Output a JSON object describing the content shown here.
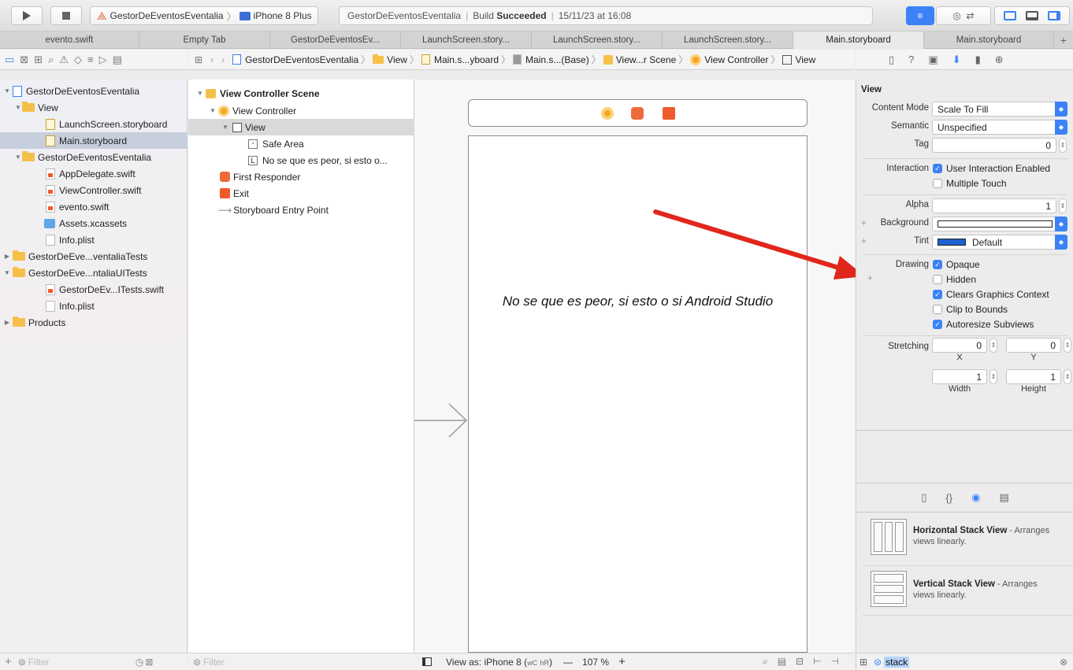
{
  "toolbar": {
    "scheme": "GestorDeEventosEventalia",
    "device": "iPhone 8 Plus",
    "status_project": "GestorDeEventosEventalia",
    "status_build_prefix": "Build",
    "status_build_result": "Succeeded",
    "status_date": "15/11/23 at 16:08"
  },
  "tabs": [
    "evento.swift",
    "Empty Tab",
    "GestorDeEventosEv...",
    "LaunchScreen.story...",
    "LaunchScreen.story...",
    "LaunchScreen.story...",
    "Main.storyboard",
    "Main.storyboard"
  ],
  "breadcrumb": [
    "GestorDeEventosEventalia",
    "View",
    "Main.s...yboard",
    "Main.s...(Base)",
    "View...r Scene",
    "View Controller",
    "View"
  ],
  "navigator": {
    "items": [
      {
        "label": "GestorDeEventosEventalia"
      },
      {
        "label": "View"
      },
      {
        "label": "LaunchScreen.storyboard"
      },
      {
        "label": "Main.storyboard"
      },
      {
        "label": "GestorDeEventosEventalia"
      },
      {
        "label": "AppDelegate.swift"
      },
      {
        "label": "ViewController.swift"
      },
      {
        "label": "evento.swift"
      },
      {
        "label": "Assets.xcassets"
      },
      {
        "label": "Info.plist"
      },
      {
        "label": "GestorDeEve...ventaliaTests"
      },
      {
        "label": "GestorDeEve...ntaliaUITests"
      },
      {
        "label": "GestorDeEv...ITests.swift"
      },
      {
        "label": "Info.plist"
      },
      {
        "label": "Products"
      }
    ],
    "filter_placeholder": "Filter"
  },
  "outline": {
    "items": [
      {
        "label": "View Controller Scene"
      },
      {
        "label": "View Controller"
      },
      {
        "label": "View"
      },
      {
        "label": "Safe Area"
      },
      {
        "label": "No se que es peor, si esto o..."
      },
      {
        "label": "First Responder"
      },
      {
        "label": "Exit"
      },
      {
        "label": "Storyboard Entry Point"
      }
    ],
    "filter_placeholder": "Filter"
  },
  "canvas": {
    "label_text": "No se que es peor, si esto o si Android Studio",
    "view_as": "View as: iPhone 8",
    "size_class_w": "wC",
    "size_class_h": "hR",
    "zoom": "107 %"
  },
  "inspector": {
    "section_title": "View",
    "content_mode_label": "Content Mode",
    "content_mode": "Scale To Fill",
    "semantic_label": "Semantic",
    "semantic": "Unspecified",
    "tag_label": "Tag",
    "tag": "0",
    "interaction_label": "Interaction",
    "user_interaction": "User Interaction Enabled",
    "multiple_touch": "Multiple Touch",
    "alpha_label": "Alpha",
    "alpha": "1",
    "background_label": "Background",
    "tint_label": "Tint",
    "tint": "Default",
    "drawing_label": "Drawing",
    "opaque": "Opaque",
    "hidden": "Hidden",
    "clears_graphics": "Clears Graphics Context",
    "clip_to_bounds": "Clip to Bounds",
    "autoresize": "Autoresize Subviews",
    "stretching_label": "Stretching",
    "stretch_x": "0",
    "stretch_y": "0",
    "stretch_w": "1",
    "stretch_h": "1",
    "x_caption": "X",
    "y_caption": "Y",
    "width_caption": "Width",
    "height_caption": "Height"
  },
  "library": {
    "items": [
      {
        "title": "Horizontal Stack View",
        "desc1": " - Arranges",
        "desc2": "views linearly."
      },
      {
        "title": "Vertical Stack View",
        "desc1": " - Arranges",
        "desc2": "views linearly."
      }
    ],
    "search_value": "stack"
  },
  "colors": {
    "accent": "#3b82f6",
    "arrow": "#e1261c",
    "scene_icon": "#f5a623"
  }
}
